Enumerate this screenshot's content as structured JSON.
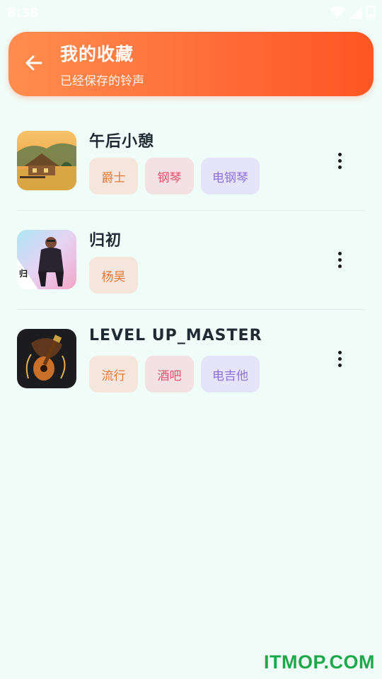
{
  "status_bar": {
    "time": "8:38"
  },
  "header": {
    "title": "我的收藏",
    "subtitle": "已经保存的铃声"
  },
  "items": [
    {
      "title": "午后小憩",
      "cover": "countryside-house-painting",
      "tags": [
        "爵士",
        "钢琴",
        "电钢琴"
      ]
    },
    {
      "title": "归初",
      "cover": "artist-portrait",
      "tags": [
        "杨昊"
      ]
    },
    {
      "title": "LEVEL UP_MASTER",
      "cover": "guitar-art",
      "tags": [
        "流行",
        "酒吧",
        "电吉他"
      ]
    }
  ],
  "watermark": "ITMOP.COM",
  "colors": {
    "header_start": "#ff8d4e",
    "header_end": "#ff5622",
    "background": "#f0fcf8"
  }
}
